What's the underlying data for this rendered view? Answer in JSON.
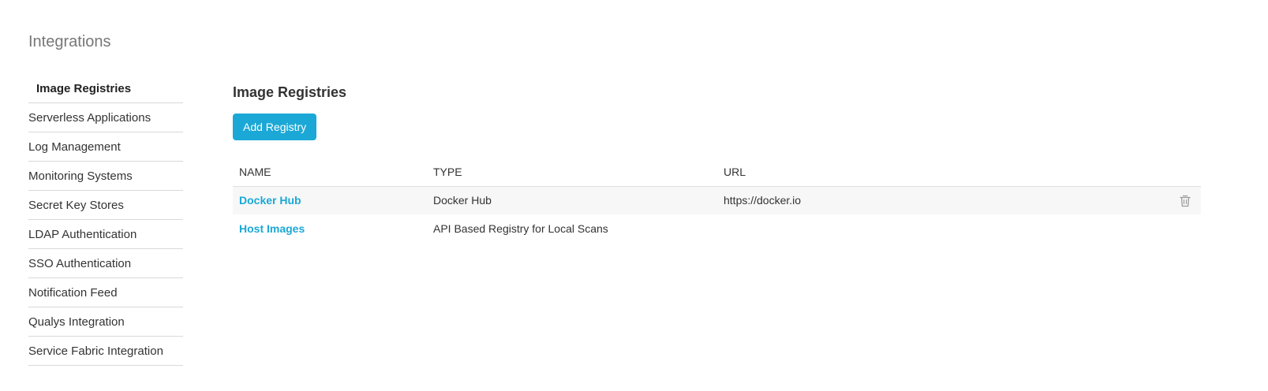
{
  "page": {
    "title": "Integrations"
  },
  "sidebar": {
    "items": [
      {
        "label": "Image Registries",
        "active": true
      },
      {
        "label": "Serverless Applications"
      },
      {
        "label": "Log Management"
      },
      {
        "label": "Monitoring Systems"
      },
      {
        "label": "Secret Key Stores"
      },
      {
        "label": "LDAP Authentication"
      },
      {
        "label": "SSO Authentication"
      },
      {
        "label": "Notification Feed"
      },
      {
        "label": "Qualys Integration"
      },
      {
        "label": "Service Fabric Integration"
      }
    ]
  },
  "main": {
    "title": "Image Registries",
    "add_button": "Add Registry",
    "table": {
      "columns": [
        "NAME",
        "TYPE",
        "URL"
      ],
      "rows": [
        {
          "name": "Docker Hub",
          "type": "Docker Hub",
          "url": "https://docker.io",
          "deletable": true
        },
        {
          "name": "Host Images",
          "type": "API Based Registry for Local Scans",
          "url": "",
          "deletable": false
        }
      ]
    }
  },
  "colors": {
    "accent": "#1ba8d6",
    "title_gray": "#777777",
    "divider": "#d9d9d9",
    "row_stripe": "#f7f7f7"
  },
  "icons": {
    "delete": "trash-icon"
  }
}
